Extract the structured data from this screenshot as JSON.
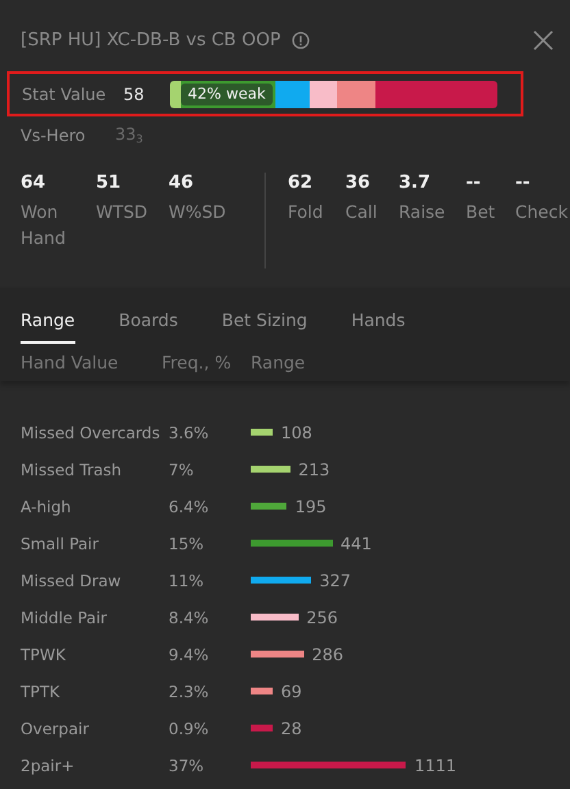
{
  "header": {
    "title": "[SRP HU] XC-DB-B vs CB OOP"
  },
  "stat": {
    "label": "Stat Value",
    "value": "58",
    "badge": "42% weak",
    "highlighted": true,
    "segments": [
      {
        "color": "#a5d36f"
      },
      {
        "color": "#3d9a2f"
      },
      {
        "color": "#10aaef"
      },
      {
        "color": "#f8bcc8"
      },
      {
        "color": "#ee8585"
      },
      {
        "color": "#c8194a"
      }
    ]
  },
  "vs_hero": {
    "label": "Vs-Hero",
    "value": "33$_{3}$"
  },
  "stat_groups": [
    [
      {
        "value": "64",
        "label": "Won Hand"
      },
      {
        "value": "51",
        "label": "WTSD"
      },
      {
        "value": "46",
        "label": "W%SD"
      }
    ],
    [
      {
        "value": "62",
        "label": "Fold"
      },
      {
        "value": "36",
        "label": "Call"
      },
      {
        "value": "3.7",
        "label": "Raise"
      },
      {
        "value": "--",
        "label": "Bet"
      },
      {
        "value": "--",
        "label": "Check"
      }
    ]
  ],
  "tabs": [
    {
      "label": "Range",
      "selected": true
    },
    {
      "label": "Boards",
      "selected": false
    },
    {
      "label": "Bet Sizing",
      "selected": false
    },
    {
      "label": "Hands",
      "selected": false
    }
  ],
  "columns": [
    "Hand Value",
    "Freq., %",
    "Range"
  ],
  "rows": [
    {
      "name": "Missed Overcards",
      "freq": "3.6%",
      "count": "108",
      "color": "#a5d36f"
    },
    {
      "name": "Missed Trash",
      "freq": "7%",
      "count": "213",
      "color": "#a5d36f"
    },
    {
      "name": "A-high",
      "freq": "6.4%",
      "count": "195",
      "color": "#4fa83a"
    },
    {
      "name": "Small Pair",
      "freq": "15%",
      "count": "441",
      "color": "#3d9a2f"
    },
    {
      "name": "Missed Draw",
      "freq": "11%",
      "count": "327",
      "color": "#10aaef"
    },
    {
      "name": "Middle Pair",
      "freq": "8.4%",
      "count": "256",
      "color": "#f8bcc8"
    },
    {
      "name": "TPWK",
      "freq": "9.4%",
      "count": "286",
      "color": "#ee8585"
    },
    {
      "name": "TPTK",
      "freq": "2.3%",
      "count": "69",
      "color": "#ee8585"
    },
    {
      "name": "Overpair",
      "freq": "0.9%",
      "count": "28",
      "color": "#c8194a"
    },
    {
      "name": "2pair+",
      "freq": "37%",
      "count": "1111",
      "color": "#c8194a"
    }
  ]
}
